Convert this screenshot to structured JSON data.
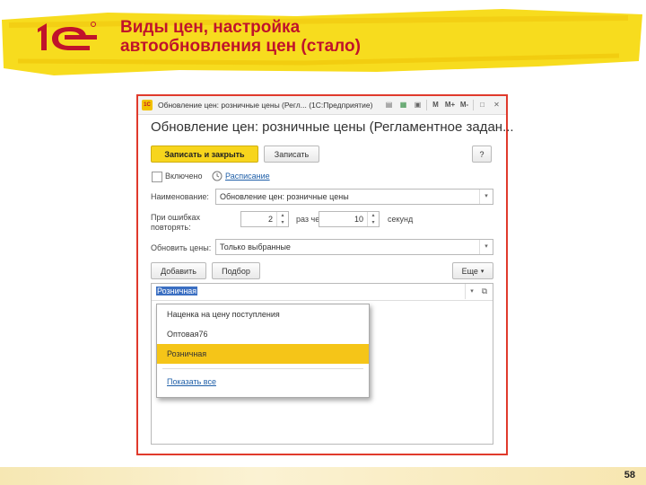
{
  "slide": {
    "title_line1": "Виды цен, настройка",
    "title_line2": "автообновления цен (стало)",
    "page_number": "58",
    "logo_text": "1С"
  },
  "window": {
    "title": "Обновление цен: розничные цены (Регл...  (1С:Предприятие)",
    "app_icon": "1C",
    "toolbar_icons": [
      "document-icon",
      "table-icon",
      "calendar-icon",
      "M",
      "M+",
      "M-",
      "restore-icon",
      "close-icon"
    ],
    "m_label": "M",
    "m_plus_label": "M+",
    "m_minus_label": "M-"
  },
  "form": {
    "title": "Обновление цен: розничные цены (Регламентное задан...",
    "save_close_label": "Записать и закрыть",
    "save_label": "Записать",
    "help_label": "?",
    "enabled_label": "Включено",
    "enabled_checked": false,
    "schedule_link": "Расписание",
    "name_label": "Наименование:",
    "name_value": "Обновление цен: розничные цены",
    "retry_label_line1": "При ошибках",
    "retry_label_line2": "повторять:",
    "retry_count": "2",
    "retry_mid_label": "раз  через:",
    "retry_interval": "10",
    "retry_unit_label": "секунд",
    "update_label": "Обновить цены:",
    "update_value": "Только выбранные",
    "add_label": "Добавить",
    "select_label": "Подбор",
    "more_label": "Еще"
  },
  "table": {
    "current_value": "Розничная"
  },
  "dropdown": {
    "items": [
      "Наценка на цену поступления",
      "Оптовая76",
      "Розничная"
    ],
    "selected_index": 2,
    "show_all_label": "Показать все"
  },
  "colors": {
    "accent_yellow": "#f7d51d",
    "title_red": "#c0132b",
    "window_border": "#e03a2c",
    "link_blue": "#1f5fa8"
  }
}
